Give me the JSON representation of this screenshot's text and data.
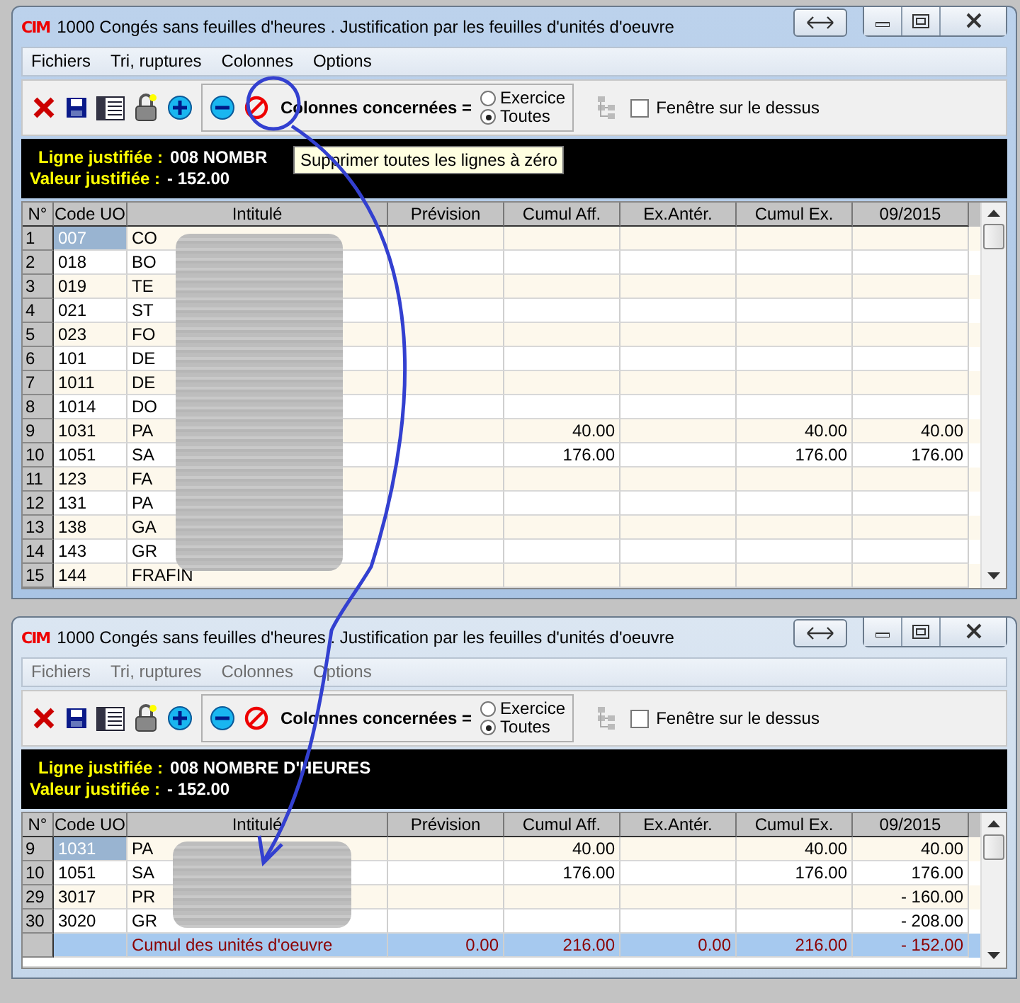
{
  "windows": [
    {
      "logo": "CIM",
      "title": "1000 Congés sans feuilles d'heures . Justification par les feuilles d'unités d'oeuvre",
      "active": true,
      "menu": [
        "Fichiers",
        "Tri, ruptures",
        "Colonnes",
        "Options"
      ],
      "columns_label": "Colonnes concernées =",
      "radios": [
        {
          "label": "Exercice",
          "selected": false
        },
        {
          "label": "Toutes",
          "selected": true
        }
      ],
      "on_top": {
        "label": "Fenêtre sur le dessus",
        "checked": false
      },
      "info": [
        {
          "label": "Ligne justifiée :",
          "value": "008 NOMBR"
        },
        {
          "label": "Valeur justifiée :",
          "value": "- 152.00"
        }
      ],
      "tooltip": "Supprimer toutes les lignes à zéro",
      "table": {
        "columns": [
          "N°",
          "Code UO",
          "Intitulé",
          "Prévision",
          "Cumul Aff.",
          "Ex.Antér.",
          "Cumul Ex.",
          "09/2015"
        ],
        "rows": [
          {
            "cells": [
              "1",
              "007",
              "CO",
              null,
              null,
              null,
              null,
              null
            ],
            "selected": true
          },
          {
            "cells": [
              "2",
              "018",
              "BO",
              null,
              null,
              null,
              null,
              null
            ],
            "selected": false
          },
          {
            "cells": [
              "3",
              "019",
              "TE",
              null,
              null,
              null,
              null,
              null
            ],
            "selected": false
          },
          {
            "cells": [
              "4",
              "021",
              "ST",
              null,
              null,
              null,
              null,
              null
            ],
            "selected": false
          },
          {
            "cells": [
              "5",
              "023",
              "FO",
              null,
              null,
              null,
              null,
              null
            ],
            "selected": false
          },
          {
            "cells": [
              "6",
              "101",
              "DE",
              null,
              null,
              null,
              null,
              null
            ],
            "selected": false
          },
          {
            "cells": [
              "7",
              "1011",
              "DE",
              null,
              null,
              null,
              null,
              null
            ],
            "selected": false
          },
          {
            "cells": [
              "8",
              "1014",
              "DO",
              null,
              null,
              null,
              null,
              null
            ],
            "selected": false
          },
          {
            "cells": [
              "9",
              "1031",
              "PA",
              null,
              "40.00",
              null,
              "40.00",
              "40.00"
            ],
            "selected": false
          },
          {
            "cells": [
              "10",
              "1051",
              "SA",
              null,
              "176.00",
              null,
              "176.00",
              "176.00"
            ],
            "selected": false
          },
          {
            "cells": [
              "11",
              "123",
              "FA",
              null,
              null,
              null,
              null,
              null
            ],
            "selected": false
          },
          {
            "cells": [
              "12",
              "131",
              "PA",
              null,
              null,
              null,
              null,
              null
            ],
            "selected": false
          },
          {
            "cells": [
              "13",
              "138",
              "GA",
              null,
              null,
              null,
              null,
              null
            ],
            "selected": false
          },
          {
            "cells": [
              "14",
              "143",
              "GR",
              null,
              null,
              null,
              null,
              null
            ],
            "selected": false
          },
          {
            "cells": [
              "15",
              "144",
              "FRAFIN",
              null,
              null,
              null,
              null,
              null
            ],
            "selected": false
          }
        ]
      }
    },
    {
      "logo": "CIM",
      "title": "1000 Congés sans feuilles d'heures . Justification par les feuilles d'unités d'oeuvre",
      "active": false,
      "menu": [
        "Fichiers",
        "Tri, ruptures",
        "Colonnes",
        "Options"
      ],
      "columns_label": "Colonnes concernées =",
      "radios": [
        {
          "label": "Exercice",
          "selected": false
        },
        {
          "label": "Toutes",
          "selected": true
        }
      ],
      "on_top": {
        "label": "Fenêtre sur le dessus",
        "checked": false
      },
      "info": [
        {
          "label": "Ligne justifiée :",
          "value": "008 NOMBRE D'HEURES"
        },
        {
          "label": "Valeur justifiée :",
          "value": "- 152.00"
        }
      ],
      "table": {
        "columns": [
          "N°",
          "Code UO",
          "Intitulé",
          "Prévision",
          "Cumul Aff.",
          "Ex.Antér.",
          "Cumul Ex.",
          "09/2015"
        ],
        "rows": [
          {
            "cells": [
              "9",
              "1031",
              "PA",
              null,
              "40.00",
              null,
              "40.00",
              "40.00"
            ],
            "selected": true
          },
          {
            "cells": [
              "10",
              "1051",
              "SA",
              null,
              "176.00",
              null,
              "176.00",
              "176.00"
            ],
            "selected": false
          },
          {
            "cells": [
              "29",
              "3017",
              "PR",
              null,
              null,
              null,
              null,
              "- 160.00"
            ],
            "selected": false
          },
          {
            "cells": [
              "30",
              "3020",
              "GR",
              null,
              null,
              null,
              null,
              "- 208.00"
            ],
            "selected": false
          }
        ],
        "total": {
          "cells": [
            null,
            null,
            "Cumul des unités d'oeuvre",
            "0.00",
            "216.00",
            "0.00",
            "216.00",
            "- 152.00"
          ]
        }
      }
    }
  ]
}
